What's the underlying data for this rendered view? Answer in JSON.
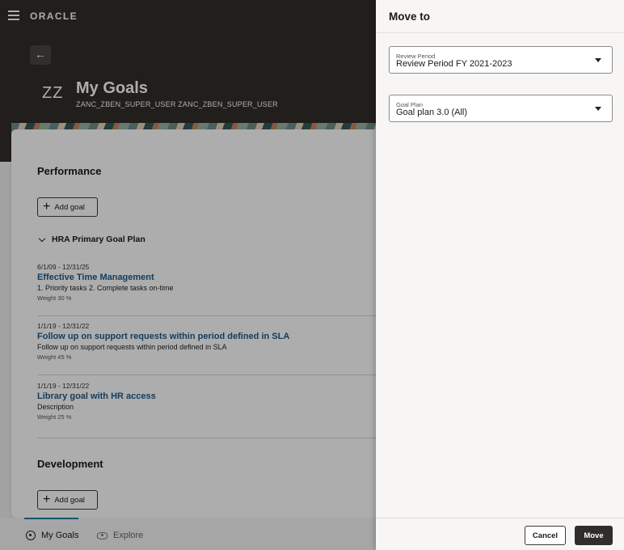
{
  "header": {
    "logo": "ORACLE",
    "back_glyph": "←",
    "initials": "ZZ",
    "title": "My Goals",
    "user": "ZANC_ZBEN_SUPER_USER ZANC_ZBEN_SUPER_USER"
  },
  "performance": {
    "title": "Performance",
    "add_goal_label": "Add goal",
    "plan_title": "HRA Primary Goal Plan",
    "goals": [
      {
        "dates": "6/1/09 - 12/31/25",
        "title": "Effective Time Management",
        "description": "1. Priority tasks 2. Complete tasks on-time",
        "weight": "Weight 30 %"
      },
      {
        "dates": "1/1/19 - 12/31/22",
        "title": "Follow up on support requests within period defined in SLA",
        "description": "Follow up on support requests within period defined in SLA",
        "weight": "Weight 45 %"
      },
      {
        "dates": "1/1/19 - 12/31/22",
        "title": "Library goal with HR access",
        "description": "Description",
        "weight": "Weight 25 %"
      }
    ]
  },
  "development": {
    "title": "Development",
    "add_goal_label": "Add goal"
  },
  "bottom_nav": {
    "my_goals": "My Goals",
    "explore": "Explore"
  },
  "drawer": {
    "title": "Move to",
    "review_period": {
      "label": "Review Period",
      "value": "Review Period FY 2021-2023"
    },
    "goal_plan": {
      "label": "Goal Plan",
      "value": "Goal plan 3.0 (All)"
    },
    "cancel_label": "Cancel",
    "move_label": "Move"
  },
  "colors": {
    "header_bg": "#312d2a",
    "link": "#1f5a88",
    "accent": "#227e9e",
    "primary_button": "#312d2a"
  },
  "icons": [
    "hamburger-icon",
    "back-arrow-icon",
    "plus-icon",
    "chevron-down-icon",
    "target-icon",
    "eye-icon",
    "dropdown-caret-icon"
  ]
}
